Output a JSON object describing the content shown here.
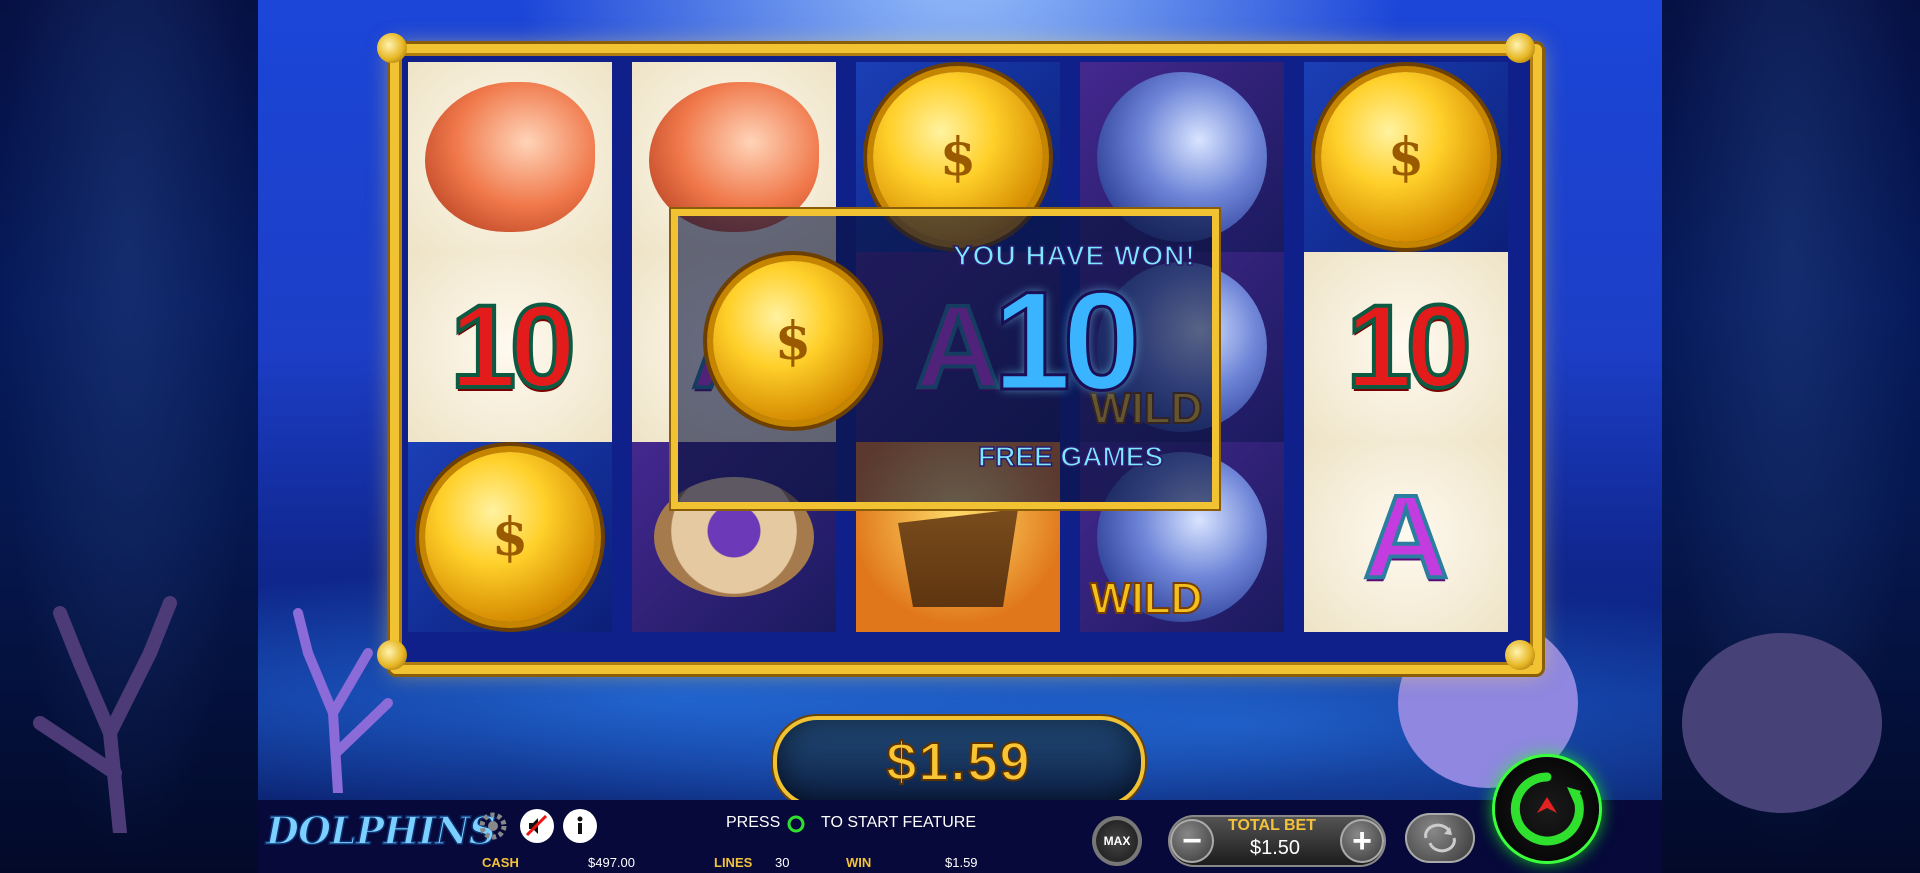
{
  "game": {
    "logo_text": "DOLPHINS"
  },
  "reels": [
    [
      "conch-shell",
      "10",
      "gold-coin"
    ],
    [
      "conch-shell",
      "A",
      "pearl-oyster"
    ],
    [
      "gold-coin",
      "A",
      "pirate-ship"
    ],
    [
      "dolphin",
      "dolphin-wild",
      "dolphin-wild"
    ],
    [
      "gold-coin",
      "10",
      "A"
    ]
  ],
  "symbols": {
    "ten": "10",
    "a": "A",
    "wild": "WILD",
    "coin_glyph": "$"
  },
  "popup": {
    "headline": "YOU HAVE WON!",
    "count": "10",
    "subline": "FREE GAMES"
  },
  "win_meter": "$1.59",
  "bottom_bar": {
    "press_text": "PRESS",
    "feature_text": "TO START FEATURE",
    "cash_label": "CASH",
    "cash_value": "$497.00",
    "lines_label": "LINES",
    "lines_value": "30",
    "win_label": "WIN",
    "win_value": "$1.59",
    "max_label": "MAX",
    "total_bet_label": "TOTAL BET",
    "total_bet_value": "$1.50",
    "minus": "−",
    "plus": "+"
  },
  "icons": [
    "gear-icon",
    "sound-off-icon",
    "info-icon",
    "spin-icon",
    "autoplay-icon"
  ],
  "colors": {
    "gold": "#f1c232",
    "spin_ring": "#3aff3a"
  }
}
